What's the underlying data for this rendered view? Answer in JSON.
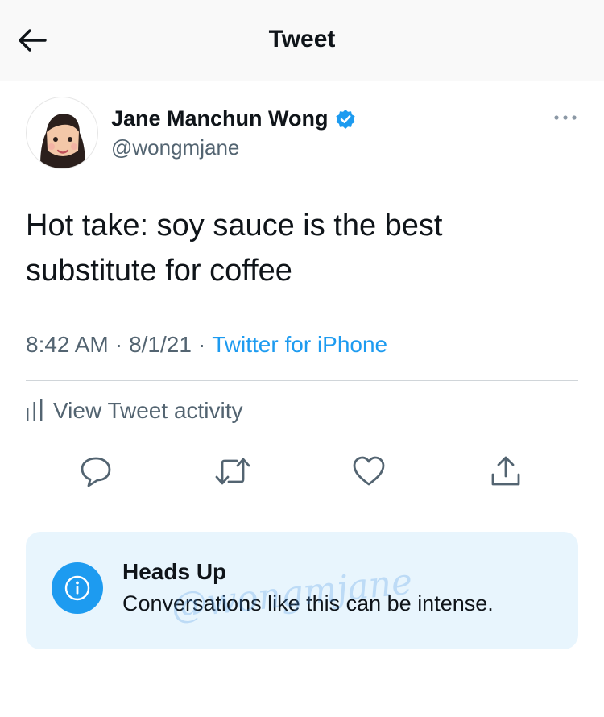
{
  "header": {
    "title": "Tweet"
  },
  "author": {
    "display_name": "Jane Manchun Wong",
    "handle": "@wongmjane",
    "verified": true
  },
  "tweet": {
    "text_line1": "Hot take: soy sauce is the best",
    "text_line2": "substitute for coffee",
    "time": "8:42 AM",
    "separator": "·",
    "date": "8/1/21",
    "source": "Twitter for iPhone"
  },
  "activity": {
    "label": "View Tweet activity"
  },
  "actions": [
    "reply-icon",
    "retweet-icon",
    "like-icon",
    "share-icon"
  ],
  "notice": {
    "title": "Heads Up",
    "body": "Conversations like this can be intense.",
    "watermark": "@wongmjane"
  },
  "colors": {
    "accent": "#1d9bf0",
    "text": "#0f1419",
    "secondary": "#536471",
    "notice_bg": "#e8f5fd"
  }
}
